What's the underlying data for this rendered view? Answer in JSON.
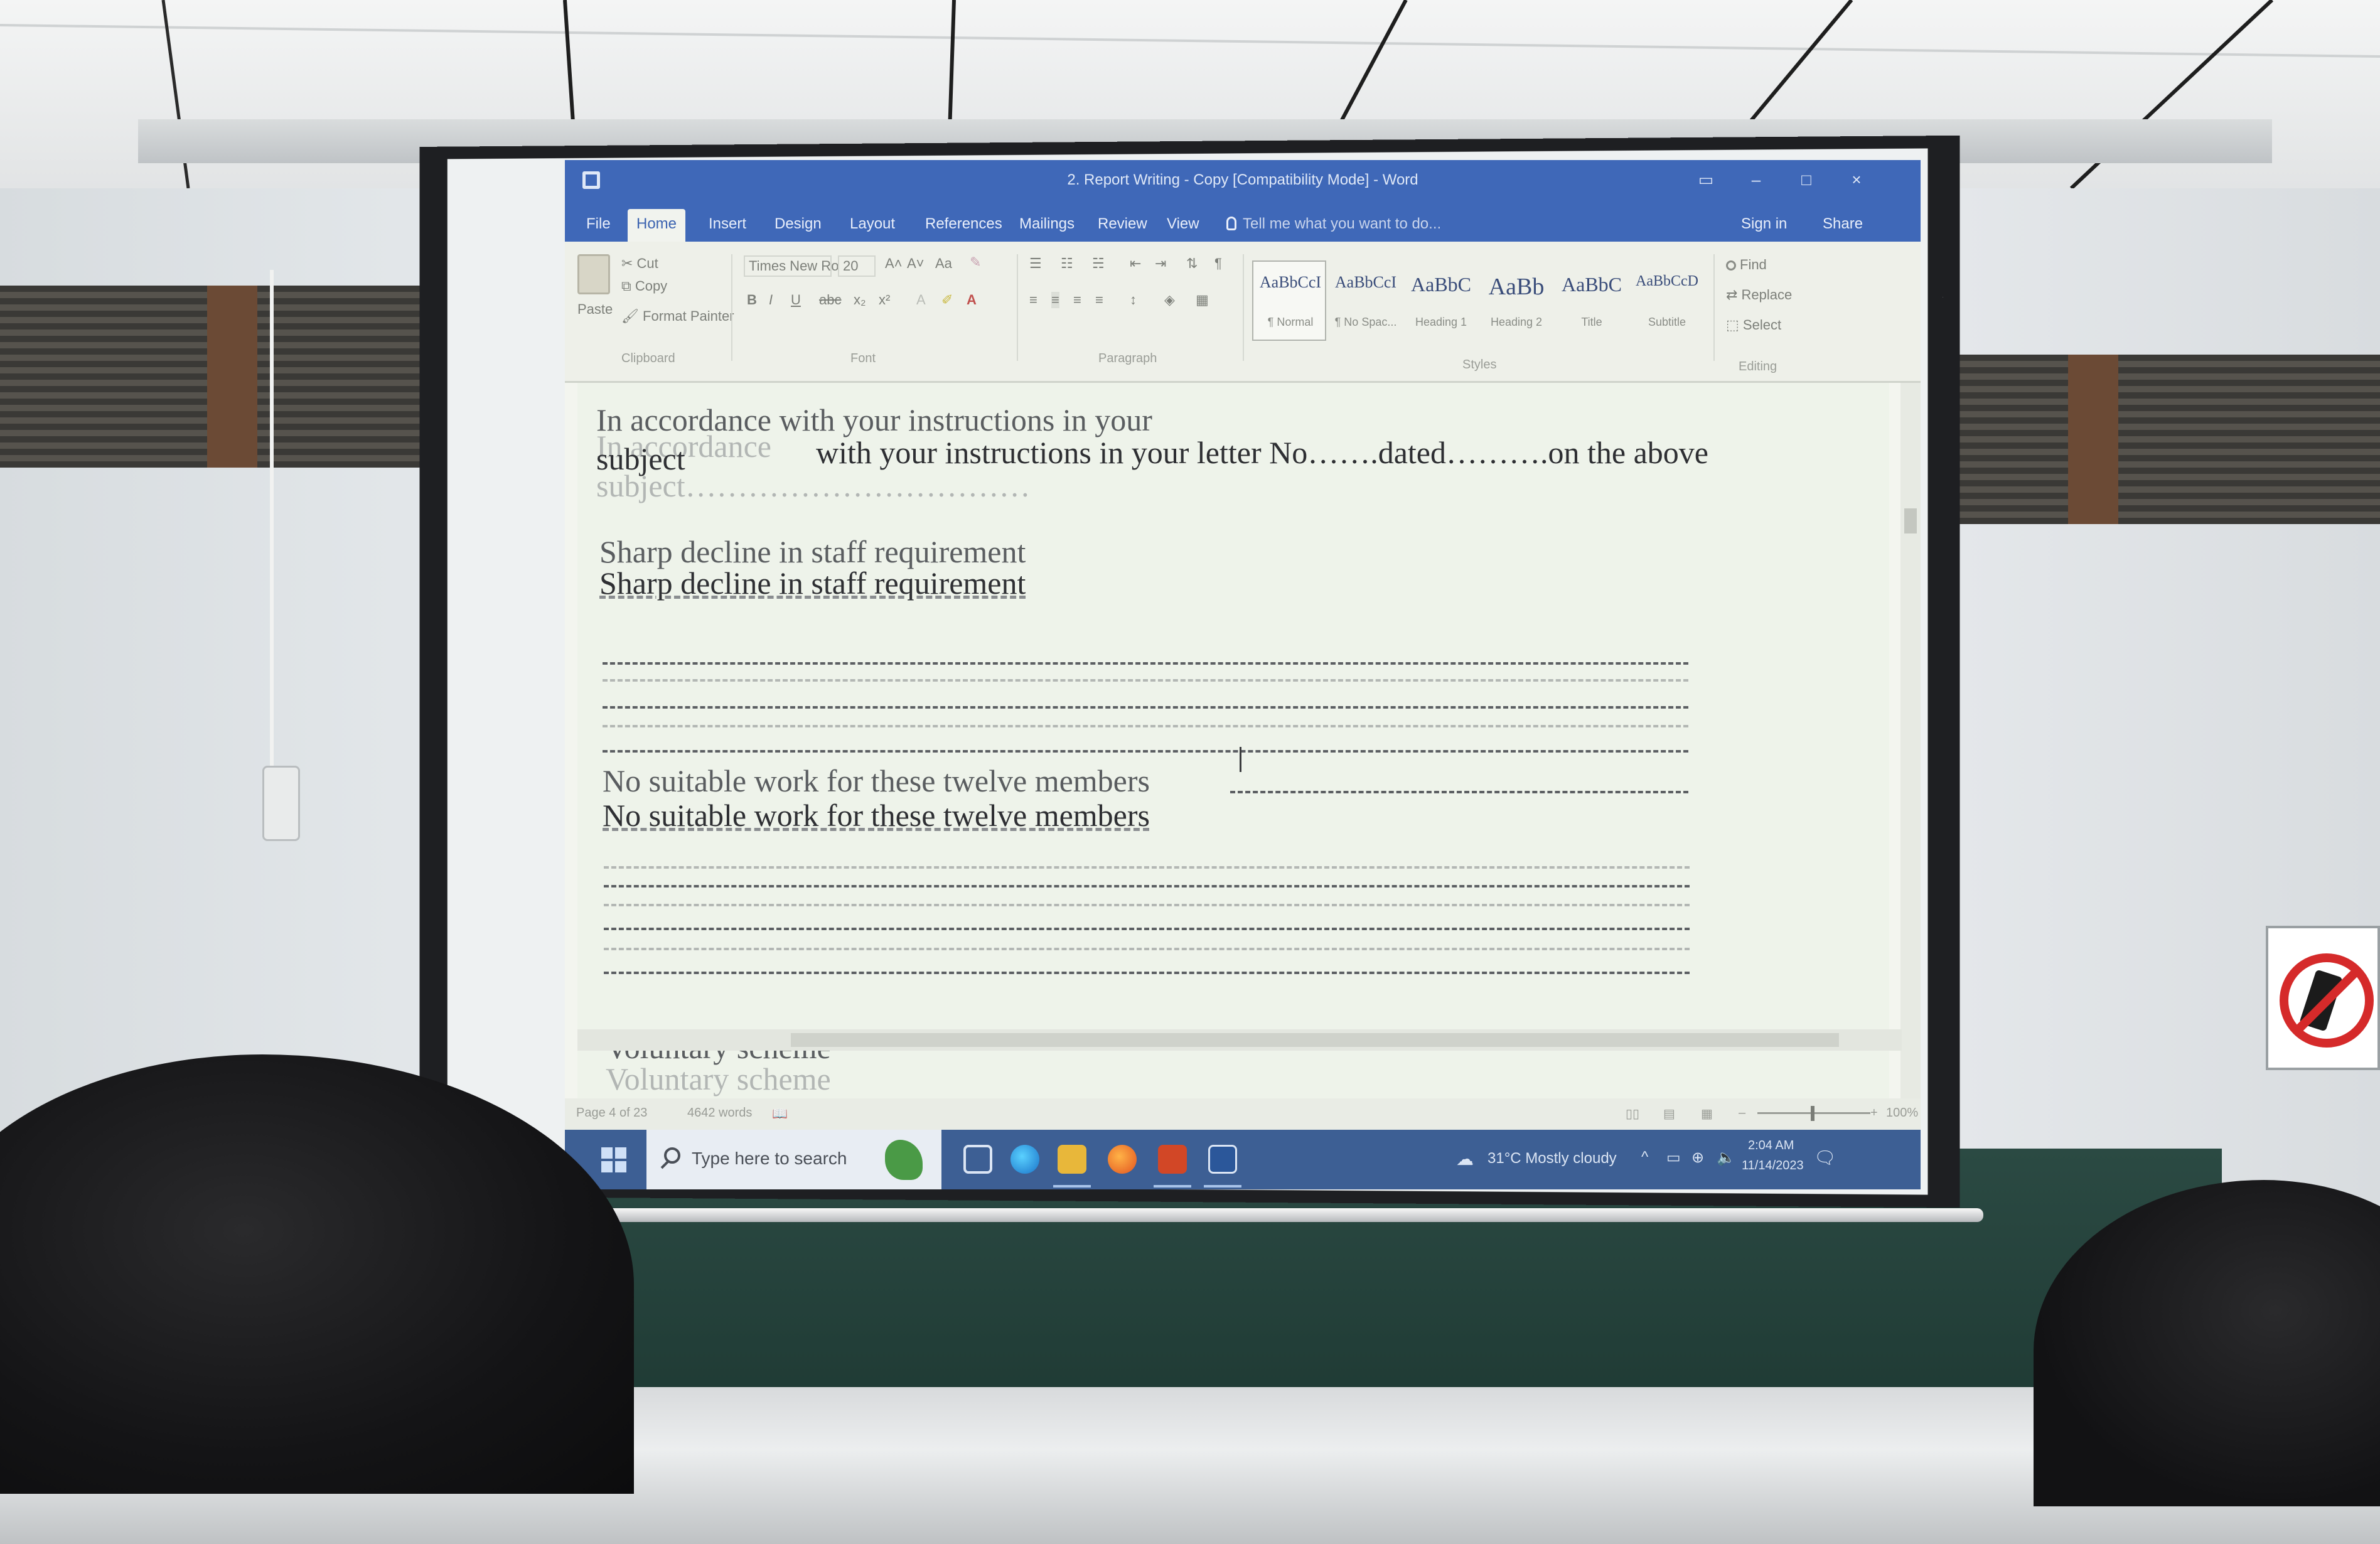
{
  "word": {
    "title": "2. Report Writing - Copy [Compatibility Mode] - Word",
    "tabs": [
      "File",
      "Home",
      "Insert",
      "Design",
      "Layout",
      "References",
      "Mailings",
      "Review",
      "View"
    ],
    "tell_me": "Tell me what you want to do...",
    "sign_in": "Sign in",
    "share": "Share",
    "clipboard": {
      "paste": "Paste",
      "cut": "Cut",
      "copy": "Copy",
      "format_painter": "Format Painter",
      "group": "Clipboard"
    },
    "font": {
      "name": "Times New Ro",
      "size": "20",
      "bold": "B",
      "italic": "I",
      "underline": "U",
      "strike": "abc",
      "subscript": "x₂",
      "superscript": "x²",
      "change_case": "Aa",
      "grow": "A˄",
      "shrink": "A˅",
      "group": "Font"
    },
    "paragraph": {
      "group": "Paragraph",
      "pilcrow": "¶"
    },
    "styles": {
      "group": "Styles",
      "items": [
        {
          "sample": "AaBbCcI",
          "name": "¶ Normal"
        },
        {
          "sample": "AaBbCcI",
          "name": "¶ No Spac..."
        },
        {
          "sample": "AaBbC",
          "name": "Heading 1"
        },
        {
          "sample": "AaBb",
          "name": "Heading 2"
        },
        {
          "sample": "AaBbC",
          "name": "Title"
        },
        {
          "sample": "AaBbCcD",
          "name": "Subtitle"
        }
      ]
    },
    "editing": {
      "find": "Find",
      "replace": "Replace",
      "select": "Select",
      "group": "Editing"
    },
    "document": {
      "ghost1": "In accordance with your instructions in your",
      "ghost1b": "In accordance",
      "line1": "with your instructions in your letter No…….dated……….on the above",
      "line1_subject": "subject",
      "ghost2": "subject……………………………",
      "heading2_ghost": "Sharp decline in staff requirement",
      "heading2": "Sharp decline in staff requirement",
      "heading3_ghost": "No suitable work for these twelve members",
      "heading3": "No suitable work for these twelve members",
      "heading4": "Voluntary scheme",
      "heading4_ghost": "Voluntary scheme"
    },
    "status": {
      "page": "Page 4 of 23",
      "words": "4642 words",
      "zoom": "100%"
    }
  },
  "taskbar": {
    "search_placeholder": "Type here to search",
    "weather": "31°C  Mostly cloudy",
    "time": "2:04 AM",
    "date": "11/14/2023"
  },
  "colors": {
    "ribbon_blue": "#3f68b8",
    "taskbar_blue": "#3d5f94",
    "sign_red": "#d52a2a",
    "blackboard": "#24423b"
  }
}
